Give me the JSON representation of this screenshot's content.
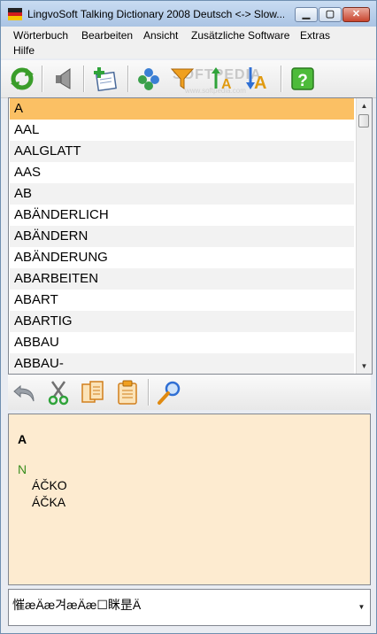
{
  "window": {
    "title": "LingvoSoft Talking Dictionary 2008 Deutsch <-> Slow...",
    "minimize_glyph": "▁",
    "maximize_glyph": "▢",
    "close_glyph": "✕"
  },
  "menu": {
    "items": [
      "Wörterbuch",
      "Bearbeiten",
      "Ansicht",
      "Zusätzliche Software",
      "Extras",
      "Hilfe"
    ]
  },
  "toolbar": {
    "icons": [
      "refresh-icon",
      "speaker-icon",
      "add-entry-icon",
      "flashcards-icon",
      "filter-icon",
      "sort-ascending-icon",
      "sort-descending-icon",
      "help-icon"
    ],
    "watermark": "SOFTPEDIA",
    "watermark_sub": "www.softpedia.com"
  },
  "wordlist": {
    "items": [
      "A",
      "AAL",
      "AALGLATT",
      "AAS",
      "AB",
      "ABÄNDERLICH",
      "ABÄNDERN",
      "ABÄNDERUNG",
      "ABARBEITEN",
      "ABART",
      "ABARTIG",
      "ABBAU",
      "ABBAU-"
    ],
    "selected_index": 0
  },
  "edit_toolbar": {
    "icons": [
      "undo-icon",
      "cut-icon",
      "copy-icon",
      "paste-icon",
      "search-icon"
    ]
  },
  "entry": {
    "headword": "A",
    "part_of_speech": "N",
    "translations": [
      "ÁČKO",
      "ÁČKA"
    ]
  },
  "search_combo": {
    "value": "慛æÄæ겨æÄæ☐眯昰Ä"
  },
  "colors": {
    "selection": "#fbc064",
    "detail_background": "#fdebd0",
    "part_of_speech": "#3a8d1d"
  }
}
